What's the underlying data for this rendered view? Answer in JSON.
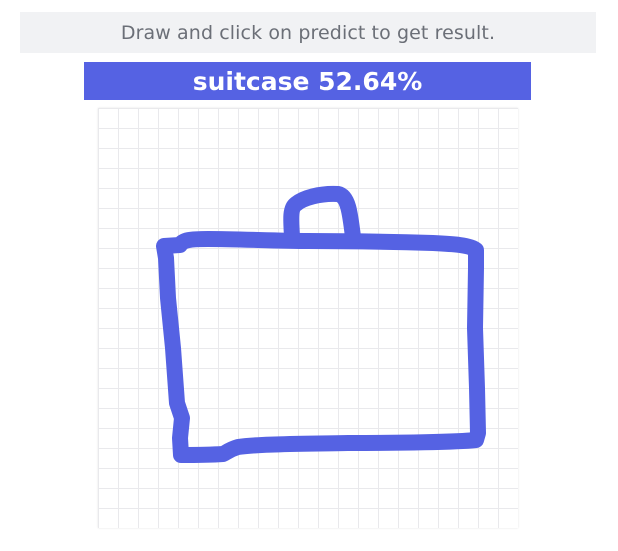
{
  "hint": {
    "text": "Draw and click on predict to get result."
  },
  "result": {
    "text": "suitcase 52.64%"
  },
  "colors": {
    "accent": "#5562e3",
    "hint_background": "#f1f2f4",
    "hint_text": "#6b6f77",
    "grid_line": "#e9e9ec"
  },
  "canvas": {
    "drawing_subject": "suitcase"
  }
}
